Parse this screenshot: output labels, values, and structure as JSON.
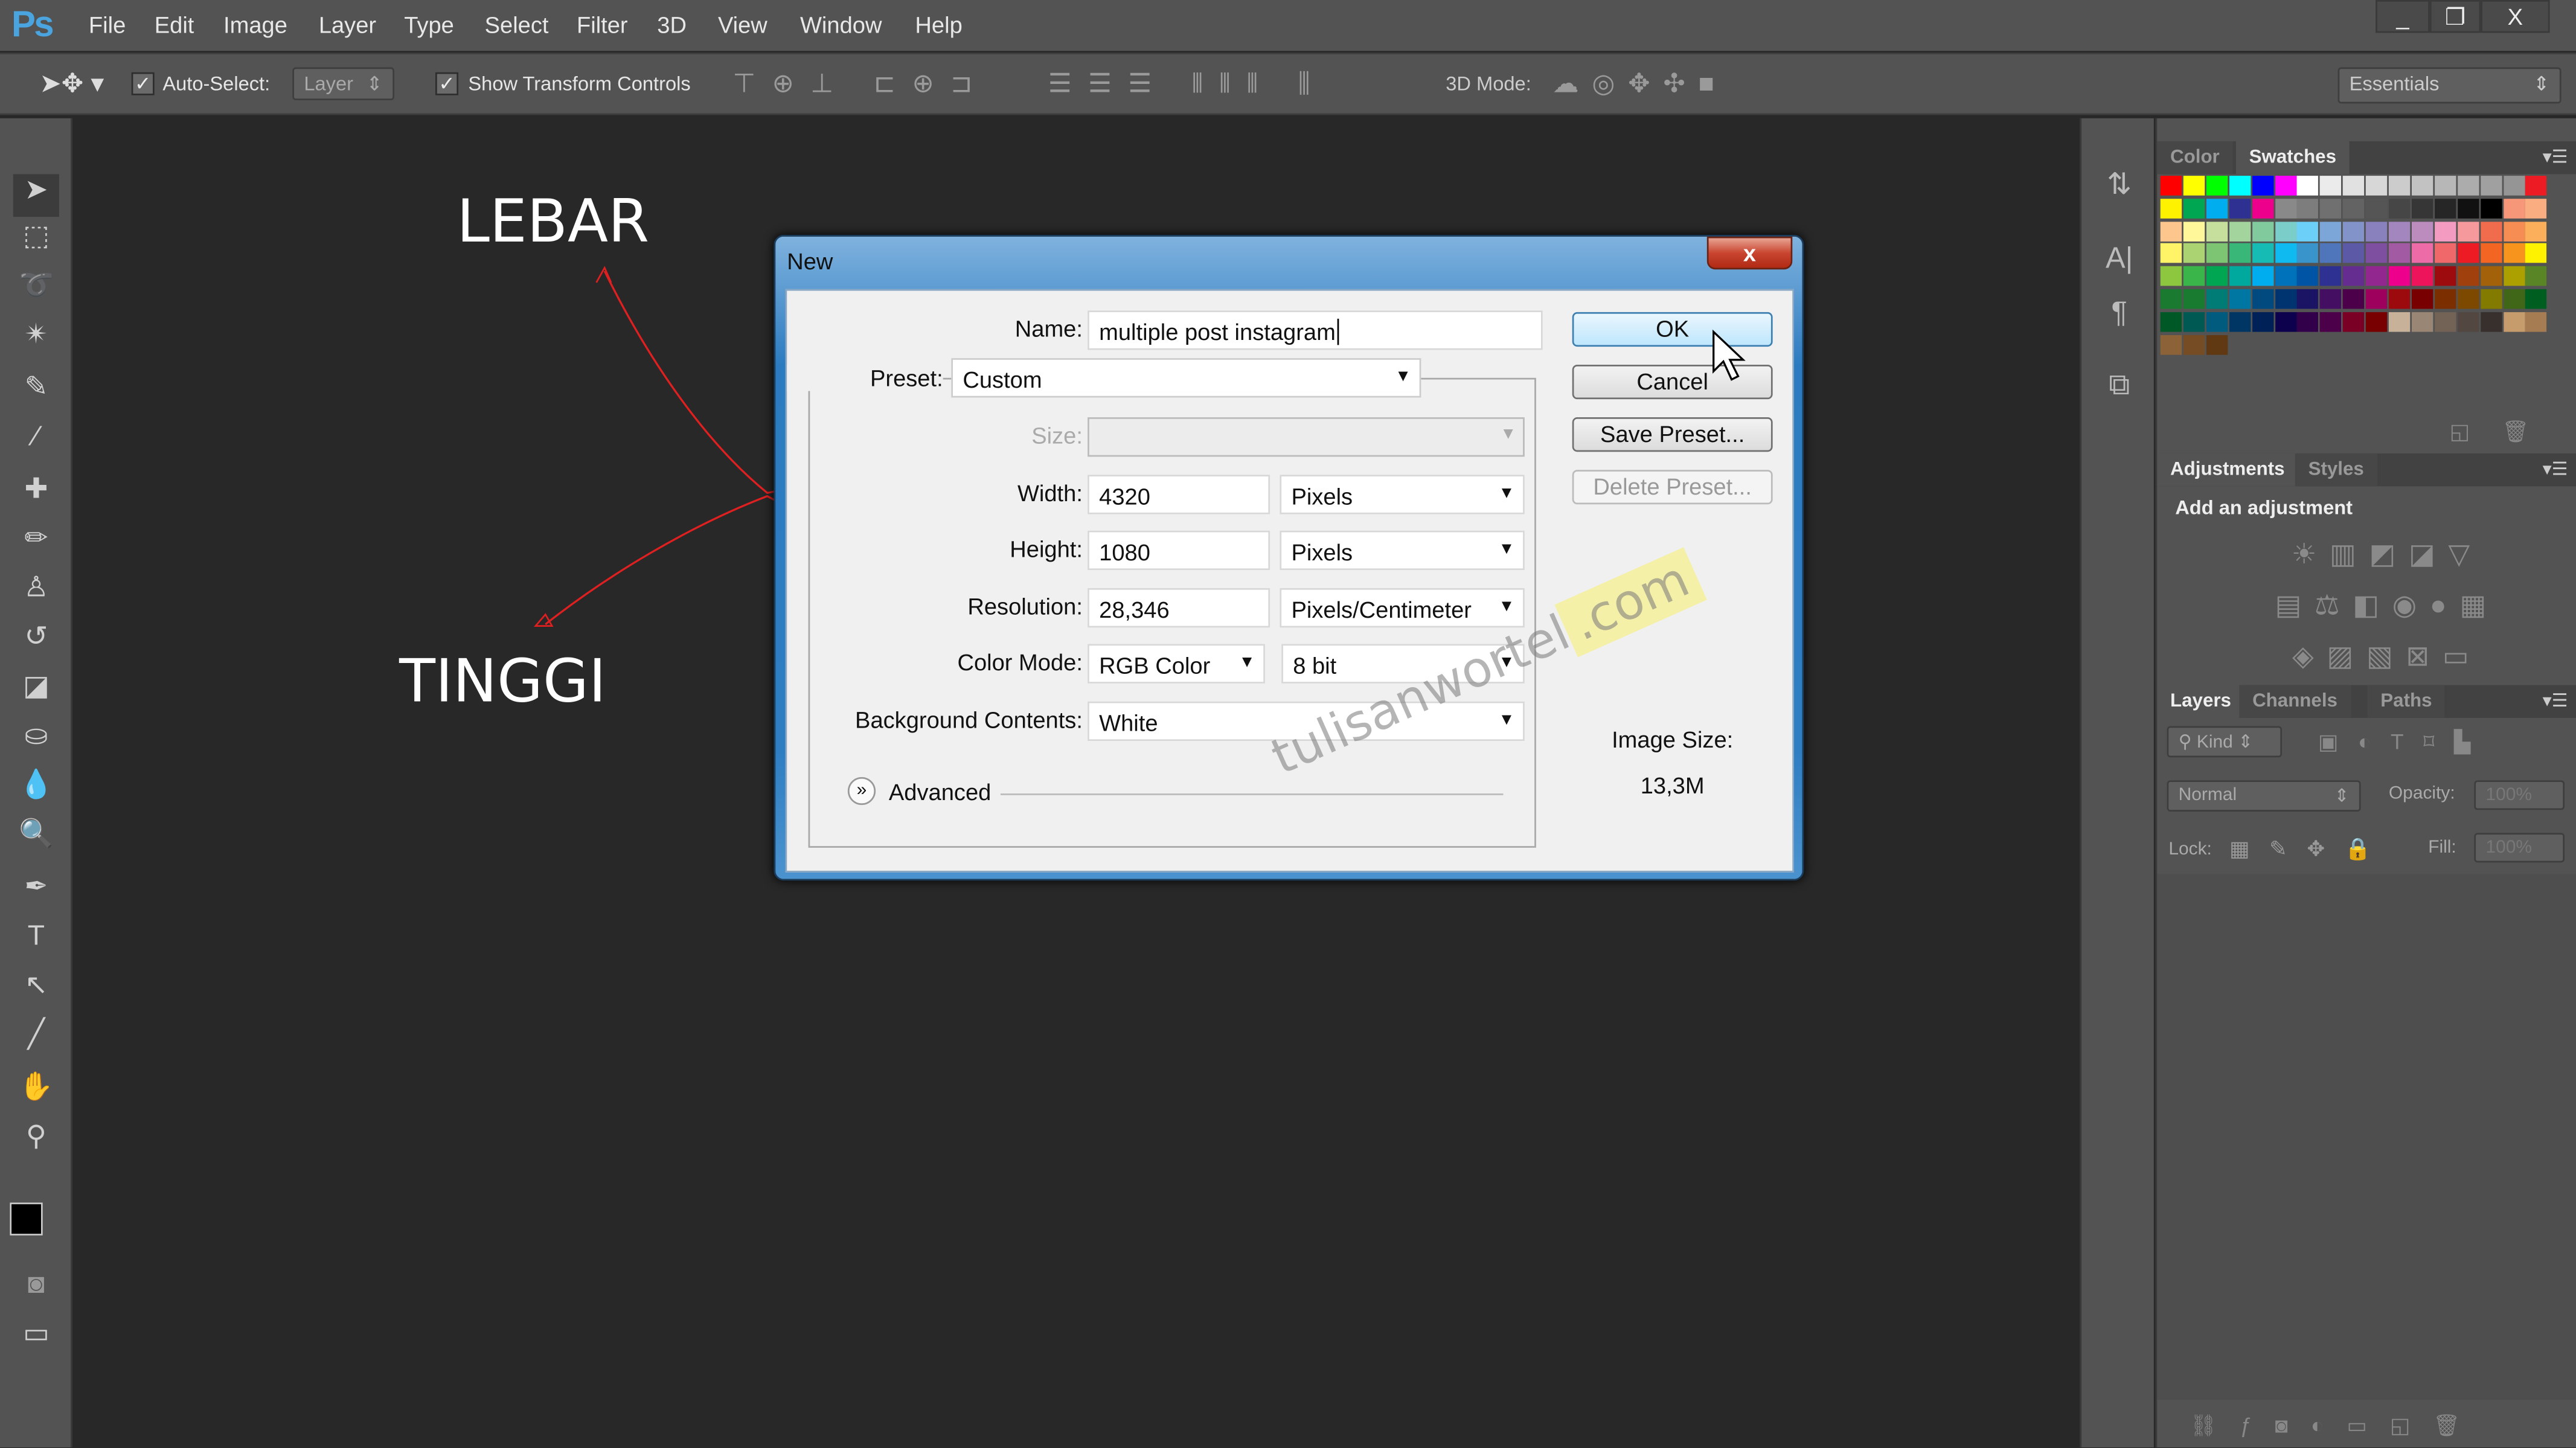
{
  "app": {
    "logo": "Ps",
    "menu": [
      "File",
      "Edit",
      "Image",
      "Layer",
      "Type",
      "Select",
      "Filter",
      "3D",
      "View",
      "Window",
      "Help"
    ],
    "window_buttons": [
      "_",
      "❐",
      "X"
    ]
  },
  "options": {
    "auto_select_label": "Auto-Select:",
    "auto_select_checked": true,
    "layer_select": "Layer",
    "show_transform_label": "Show Transform Controls",
    "show_transform_checked": true,
    "mode_3d_label": "3D Mode:",
    "workspace": "Essentials"
  },
  "annotations": {
    "width_label": "LEBAR",
    "height_label": "TINGGI",
    "arrow_color": "#e02020"
  },
  "dialog": {
    "title": "New",
    "close": "x",
    "name_label": "Name:",
    "name_value": "multiple post instagram",
    "preset_label": "Preset:",
    "preset_value": "Custom",
    "size_label": "Size:",
    "size_value": "",
    "width_label": "Width:",
    "width_value": "4320",
    "width_unit": "Pixels",
    "height_label": "Height:",
    "height_value": "1080",
    "height_unit": "Pixels",
    "resolution_label": "Resolution:",
    "resolution_value": "28,346",
    "resolution_unit": "Pixels/Centimeter",
    "color_mode_label": "Color Mode:",
    "color_mode_value": "RGB Color",
    "bit_depth": "8 bit",
    "background_label": "Background Contents:",
    "background_value": "White",
    "advanced_label": "Advanced",
    "buttons": {
      "ok": "OK",
      "cancel": "Cancel",
      "save_preset": "Save Preset...",
      "delete_preset": "Delete Preset..."
    },
    "image_size_label": "Image Size:",
    "image_size_value": "13,3M"
  },
  "watermark": {
    "text": "tulisanwortel",
    "suffix": ".com"
  },
  "panels": {
    "swatch_tabs": [
      "Color",
      "Swatches"
    ],
    "swatches": [
      "#ff0000",
      "#ffff00",
      "#00ff00",
      "#00ffff",
      "#0000ff",
      "#ff00ff",
      "#ffffff",
      "#ebebeb",
      "#e1e1e1",
      "#d7d7d7",
      "#cccccc",
      "#c2c2c2",
      "#b7b7b7",
      "#acacac",
      "#a0a0a0",
      "#959595",
      "#ed1c24",
      "#fff200",
      "#00a651",
      "#00aeef",
      "#2e3192",
      "#ec008c",
      "#898989",
      "#7d7d7d",
      "#707070",
      "#636363",
      "#555555",
      "#464646",
      "#363636",
      "#262626",
      "#111111",
      "#000000",
      "#f7977a",
      "#fbad82",
      "#fdc68c",
      "#fff799",
      "#c6df9c",
      "#a4d49d",
      "#81ca9d",
      "#7bcdc9",
      "#6ccff7",
      "#7ca6d8",
      "#8293ca",
      "#8881be",
      "#a286bd",
      "#bc8cbf",
      "#f49bc1",
      "#f5999d",
      "#f16c4d",
      "#f68e54",
      "#fbaf5a",
      "#fff467",
      "#acd372",
      "#7dc473",
      "#39b778",
      "#16bcb4",
      "#0ebaf0",
      "#3994cb",
      "#4f75bb",
      "#5c5aa7",
      "#7e4ea1",
      "#a25ba3",
      "#ed6ba6",
      "#f1686b",
      "#ed1c24",
      "#f26522",
      "#f7941d",
      "#fff200",
      "#8dc63f",
      "#39b54a",
      "#00a651",
      "#00a99d",
      "#00aeef",
      "#0072bc",
      "#0054a6",
      "#2e3192",
      "#662d91",
      "#92278f",
      "#ec008c",
      "#ed145b",
      "#9e0b0f",
      "#a0410d",
      "#a36209",
      "#aba000",
      "#598527",
      "#1a7b30",
      "#197b30",
      "#007c76",
      "#0076a3",
      "#004a80",
      "#003471",
      "#1b1464",
      "#440e62",
      "#4b0049",
      "#9e005d",
      "#9d0a0e",
      "#790000",
      "#7b2e00",
      "#7d4900",
      "#827b00",
      "#406618",
      "#005e20",
      "#005826",
      "#005952",
      "#005b7f",
      "#003663",
      "#002157",
      "#0d004c",
      "#32004b",
      "#4b0049",
      "#7a0026",
      "#790000",
      "#c7b299",
      "#998675",
      "#736357",
      "#534741",
      "#37302d",
      "#c69c6d",
      "#a67c52",
      "#8c6239",
      "#754c24",
      "#603913"
    ],
    "adjust_tabs": [
      "Adjustments",
      "Styles"
    ],
    "adjust_heading": "Add an adjustment",
    "layer_tabs": [
      "Layers",
      "Channels",
      "Paths"
    ],
    "kind_label": "Kind",
    "blend_mode": "Normal",
    "opacity_label": "Opacity:",
    "opacity_value": "100%",
    "lock_label": "Lock:",
    "fill_label": "Fill:",
    "fill_value": "100%"
  }
}
